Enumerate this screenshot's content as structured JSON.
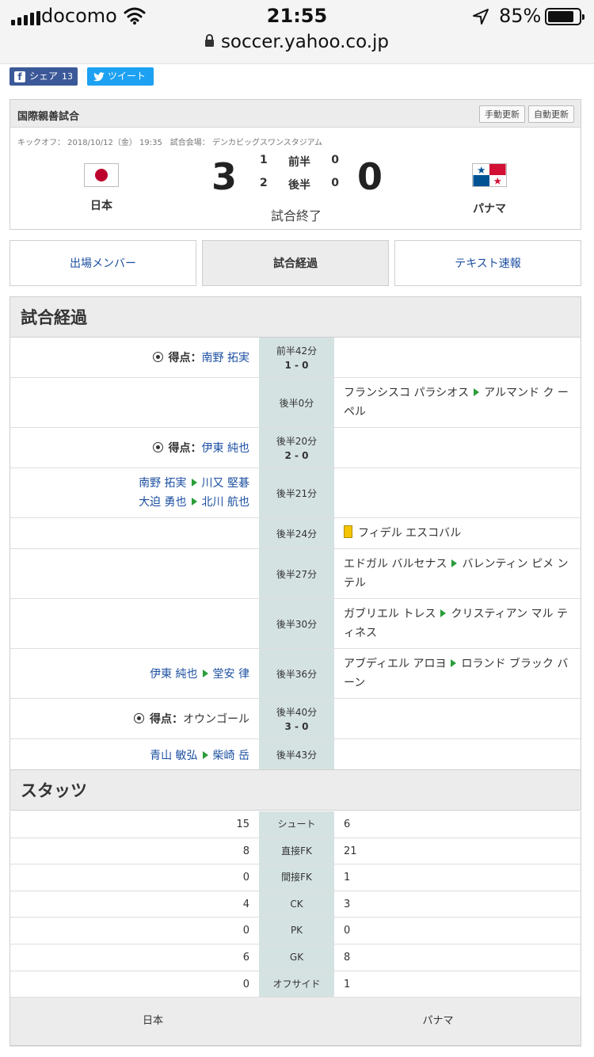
{
  "status_bar": {
    "carrier": "docomo",
    "time": "21:55",
    "battery_pct": "85%",
    "battery_level": 0.85,
    "url": "soccer.yahoo.co.jp"
  },
  "share": {
    "facebook_label": "シェア",
    "facebook_count": "13",
    "tweet_label": "ツイート"
  },
  "match": {
    "competition": "国際親善試合",
    "manual_update": "手動更新",
    "auto_update": "自動更新",
    "kickoff_info": "キックオフ： 2018/10/12（金） 19:35　試合会場： デンカビッグスワンスタジアム",
    "home_team": "日本",
    "away_team": "パナマ",
    "home_score": "3",
    "away_score": "0",
    "first_half": {
      "home": "1",
      "label": "前半",
      "away": "0"
    },
    "second_half": {
      "home": "2",
      "label": "後半",
      "away": "0"
    },
    "status": "試合終了"
  },
  "tabs": [
    {
      "label": "出場メンバー",
      "active": false
    },
    {
      "label": "試合経過",
      "active": true
    },
    {
      "label": "テキスト速報",
      "active": false
    }
  ],
  "timeline": {
    "title": "試合経過",
    "goal_label": "得点：",
    "rows": [
      {
        "time": "前半42分",
        "score": "1 - 0",
        "left_goal": "南野 拓実"
      },
      {
        "time": "後半0分",
        "right_sub": {
          "out": "フランシスコ パラシオス",
          "in": "アルマンド ク ーペル"
        }
      },
      {
        "time": "後半20分",
        "score": "2 - 0",
        "left_goal": "伊東 純也"
      },
      {
        "time": "後半21分",
        "left_subs": [
          {
            "out": "南野 拓実",
            "in": "川又 堅碁"
          },
          {
            "out": "大迫 勇也",
            "in": "北川 航也"
          }
        ]
      },
      {
        "time": "後半24分",
        "right_card": "フィデル エスコバル"
      },
      {
        "time": "後半27分",
        "right_sub": {
          "out": "エドガル バルセナス",
          "in": "バレンティン ピメ ンテル"
        }
      },
      {
        "time": "後半30分",
        "right_sub": {
          "out": "ガブリエル トレス",
          "in": "クリスティアン マル ティネス"
        }
      },
      {
        "time": "後半36分",
        "left_sub": {
          "out": "伊東 純也",
          "in": "堂安 律"
        },
        "right_sub": {
          "out": "アブディエル アロヨ",
          "in": "ロランド ブラック バーン"
        }
      },
      {
        "time": "後半40分",
        "score": "3 - 0",
        "left_goal_plain": "オウンゴール"
      },
      {
        "time": "後半43分",
        "left_sub": {
          "out": "青山 敏弘",
          "in": "柴崎 岳"
        }
      }
    ]
  },
  "stats": {
    "title": "スタッツ",
    "rows": [
      {
        "label": "シュート",
        "home": "15",
        "away": "6"
      },
      {
        "label": "直接FK",
        "home": "8",
        "away": "21"
      },
      {
        "label": "間接FK",
        "home": "0",
        "away": "1"
      },
      {
        "label": "CK",
        "home": "4",
        "away": "3"
      },
      {
        "label": "PK",
        "home": "0",
        "away": "0"
      },
      {
        "label": "GK",
        "home": "6",
        "away": "8"
      },
      {
        "label": "オフサイド",
        "home": "0",
        "away": "1"
      }
    ],
    "footer_home": "日本",
    "footer_away": "パナマ"
  }
}
